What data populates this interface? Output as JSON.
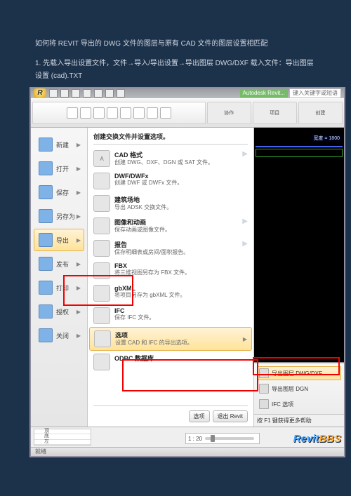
{
  "doc": {
    "title": "如何将 REVIT 导出的 DWG 文件的图层与原有 CAD 文件的图层设置相匹配",
    "step1": "1. 先载入导出设置文件，文件→导入/导出设置→导出图层 DWG/DXF 载入文件：导出图层设置 (cad).TXT"
  },
  "qat": {
    "app_initial": "R",
    "tab_label": "Autodesk Revit...",
    "search_placeholder": "键入关键字或短语"
  },
  "ribbon": {
    "collab": "协作",
    "project": "项目",
    "create": "创建"
  },
  "left_menu": [
    {
      "label": "新建",
      "icon": "new"
    },
    {
      "label": "打开",
      "icon": "open"
    },
    {
      "label": "保存",
      "icon": "save"
    },
    {
      "label": "另存为",
      "icon": "saveas"
    },
    {
      "label": "导出",
      "icon": "export",
      "hov": true
    },
    {
      "label": "发布",
      "icon": "publish"
    },
    {
      "label": "打印",
      "icon": "print"
    },
    {
      "label": "授权",
      "icon": "license"
    },
    {
      "label": "关闭",
      "icon": "close"
    }
  ],
  "center": {
    "header": "创建交换文件并设置选项。",
    "rows": [
      {
        "t1": "CAD 格式",
        "t2": "创建 DWG、DXF、DGN 或 SAT 文件。",
        "icon": "A",
        "arrow": true
      },
      {
        "t1": "DWF/DWFx",
        "t2": "创建 DWF 或 DWFx 文件。",
        "icon": "dwf"
      },
      {
        "t1": "建筑场地",
        "t2": "导出 ADSK 交换文件。",
        "icon": "site"
      },
      {
        "t1": "图像和动画",
        "t2": "保存动画或图像文件。",
        "icon": "img",
        "arrow": true
      },
      {
        "t1": "报告",
        "t2": "保存明细表或房间/面积报告。",
        "icon": "rpt",
        "arrow": true
      },
      {
        "t1": "FBX",
        "t2": "将三维视图另存为 FBX 文件。",
        "icon": "fbx"
      },
      {
        "t1": "gbXML",
        "t2": "将项目另存为 gbXML 文件。",
        "icon": "gb"
      },
      {
        "t1": "IFC",
        "t2": "保存 IFC 文件。",
        "icon": "ifc"
      },
      {
        "t1": "选项",
        "t2": "设置 CAD 和 IFC 的导出选项。",
        "icon": "opt",
        "hov": true,
        "arrow": true
      },
      {
        "t1": "ODBC 数据库",
        "t2": "",
        "icon": "odbc"
      }
    ],
    "footer": {
      "options": "选项",
      "exit": "退出 Revit"
    }
  },
  "canvas": {
    "dim": "宽度 = 1800"
  },
  "flyout": {
    "rows": [
      {
        "label": "导出图层 DWG/DXF",
        "hov": true
      },
      {
        "label": "导出图层 DGN"
      },
      {
        "label": "IFC 选项"
      }
    ],
    "hint": "按 F1 键获得更多帮助"
  },
  "bottom": {
    "palette": [
      "顶",
      "底",
      "左"
    ],
    "zoom_min": "1 : 20",
    "status": "就绪",
    "watermark1": "Revit",
    "watermark2": "BBS"
  }
}
